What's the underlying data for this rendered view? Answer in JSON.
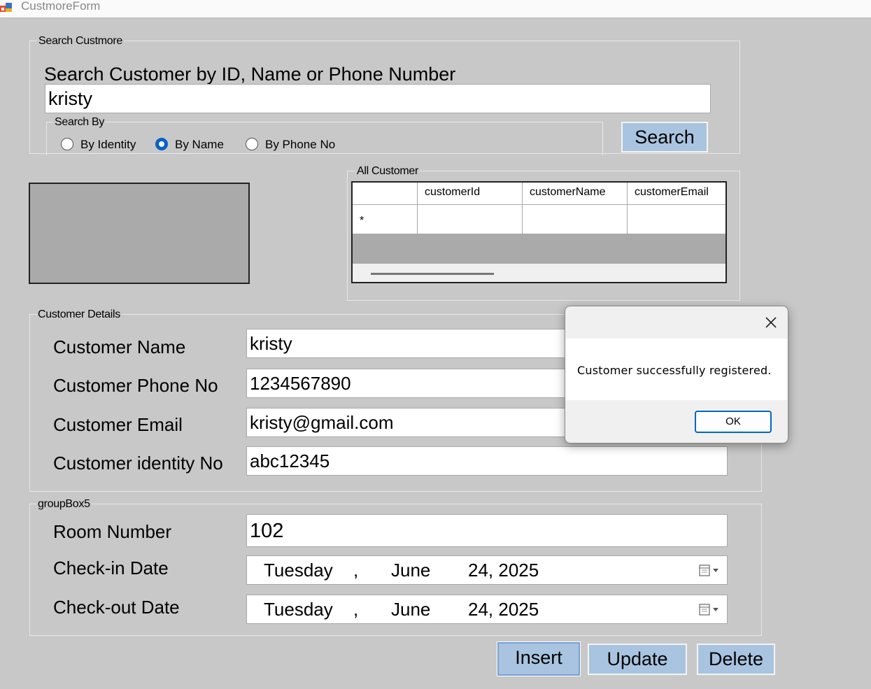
{
  "window": {
    "title": "CustmoreForm"
  },
  "search": {
    "group_label": "Search Custmore",
    "heading": "Search Customer by ID, Name or Phone Number",
    "input_value": "kristy",
    "search_by_label": "Search By",
    "options": [
      "By Identity",
      "By Name",
      "By Phone No"
    ],
    "selected": "By Name",
    "search_button": "Search"
  },
  "grid": {
    "group_label": "All Customer",
    "columns": [
      "customerId",
      "customerName",
      "customerEmail"
    ],
    "new_row_marker": "*"
  },
  "details": {
    "group_label": "Customer Details",
    "name_label": "Customer Name",
    "name_value": "kristy",
    "phone_label": "Customer Phone No",
    "phone_value": "1234567890",
    "email_label": "Customer Email",
    "email_value": "kristy@gmail.com",
    "identity_label": "Customer identity No",
    "identity_value": "abc12345"
  },
  "room": {
    "group_label": "groupBox5",
    "room_label": "Room Number",
    "room_value": "102",
    "checkin_label": "Check-in Date",
    "checkin": {
      "weekday": "Tuesday",
      "month": "June",
      "day_year": "24, 2025"
    },
    "checkout_label": "Check-out Date",
    "checkout": {
      "weekday": "Tuesday",
      "month": "June",
      "day_year": "24, 2025"
    }
  },
  "actions": {
    "insert": "Insert",
    "update": "Update",
    "delete": "Delete"
  },
  "dialog": {
    "message": "Customer successfully registered.",
    "ok": "OK"
  },
  "colors": {
    "form_bg": "#c8c8c8",
    "button_bg": "#a8c4e0",
    "radio_selected": "#0a5fc9",
    "dialog_ok_border": "#0067c0"
  }
}
